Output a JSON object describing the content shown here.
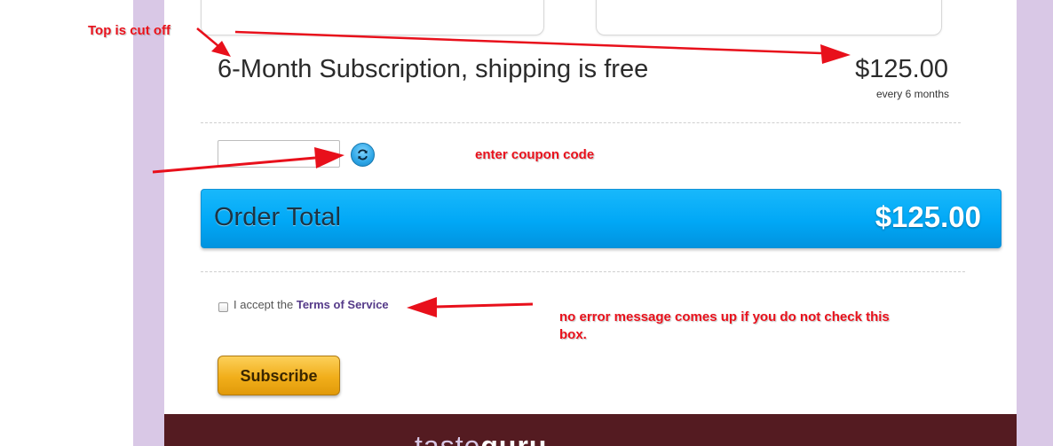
{
  "plan": {
    "title": "6-Month Subscription, shipping is free",
    "price": "$125.00",
    "period": "every 6 months"
  },
  "coupon": {
    "value": "",
    "placeholder": "",
    "refresh_icon": "refresh-icon"
  },
  "order": {
    "label": "Order Total",
    "amount": "$125.00"
  },
  "terms": {
    "prefix": "I accept the",
    "link": "Terms of Service",
    "checked": false
  },
  "subscribe": {
    "label": "Subscribe"
  },
  "footer": {
    "logo_part1": "taste",
    "logo_part2": "guru"
  },
  "annotations": {
    "top_cut_off": "Top is cut off",
    "coupon_note": "enter coupon code",
    "error_note_line1": "no error message comes up if you do not check this",
    "error_note_line2": "box."
  },
  "colors": {
    "accent_blue": "#01a8f6",
    "subscribe_gold": "#f1ae1a",
    "side_lavender": "#d9c8e6",
    "footer_maroon": "#541b21",
    "annotation_red": "#e8101b",
    "link_purple": "#553a89"
  }
}
